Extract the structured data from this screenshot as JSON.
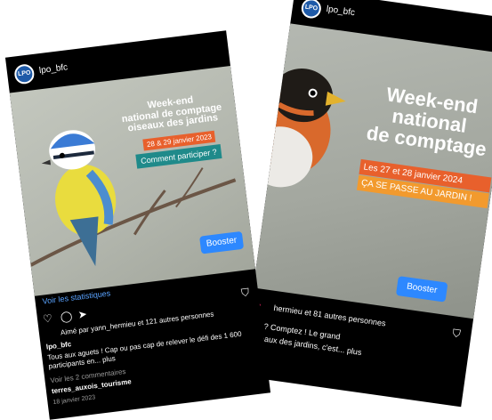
{
  "post1": {
    "account": "lpo_bfc",
    "avatar_text": "LPO",
    "banner_line1": "Week-end",
    "banner_line2": "national de comptage",
    "banner_line3": "oiseaux des jardins",
    "date_pill": "28 & 29 janvier 2023",
    "cta_pill": "Comment participer ?",
    "booster": "Booster",
    "stats_link": "Voir les statistiques",
    "likes": "Aimé par yann_hermieu et 121 autres personnes",
    "caption_account": "lpo_bfc",
    "caption_text": "Tous aux aguets ! Cap ou pas cap de relever le défi des 1 600 participants en... plus",
    "comments_link": "Voir les 2 commentaires",
    "comment_account": "terres_auxois_tourisme",
    "date": "18 janvier 2023",
    "colors": {
      "date_pill": "#e8602c",
      "cta_pill": "#1f8a8a"
    }
  },
  "post2": {
    "account": "lpo_bfc",
    "avatar_text": "LPO",
    "banner_line1": "Week-end",
    "banner_line2": "national",
    "banner_line3": "de comptage",
    "date_pill": "Les 27 et 28 janvier 2024",
    "cta_pill": "ÇA SE PASSE AU JARDIN !",
    "booster": "Booster",
    "likes": "hermieu et 81 autres personnes",
    "caption_line1": "? Comptez ! Le grand",
    "caption_line2": "oiseaux des jardins, c'est... plus",
    "colors": {
      "date_pill": "#e8602c",
      "cta_pill": "#f29a2e"
    }
  }
}
